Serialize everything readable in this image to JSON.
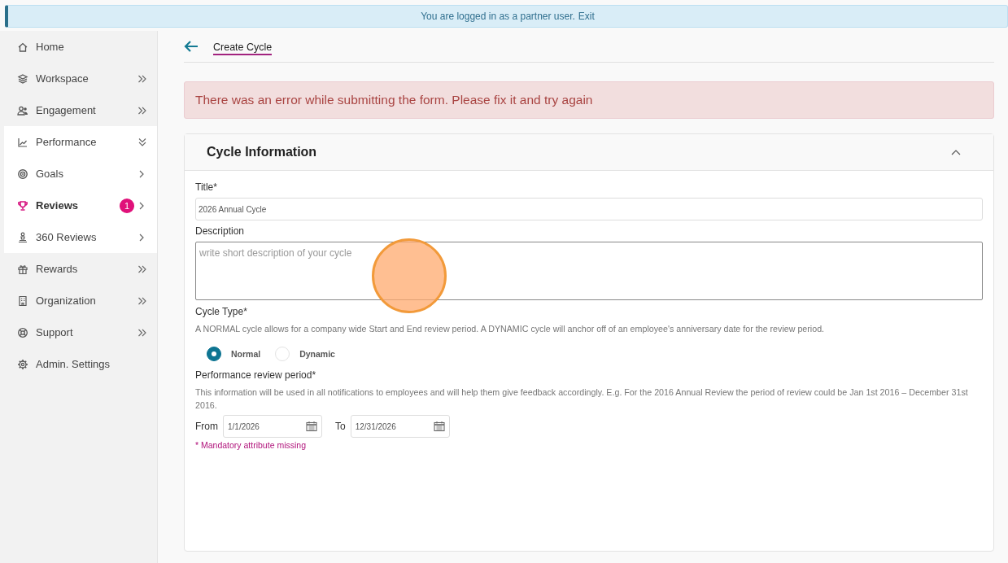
{
  "banner": {
    "text": "You are logged in as a partner user.",
    "link": "Exit"
  },
  "sidebar": {
    "items": [
      {
        "label": "Home",
        "kind": "plain",
        "selected": false
      },
      {
        "label": "Workspace",
        "kind": "module",
        "selected": false
      },
      {
        "label": "Engagement",
        "kind": "module",
        "selected": false
      },
      {
        "label": "Performance",
        "kind": "module",
        "selected": false,
        "expanded": true,
        "children": [
          {
            "label": "Goals",
            "kind": "page",
            "selected": false
          },
          {
            "label": "Reviews",
            "kind": "page",
            "selected": true,
            "badge": "1"
          },
          {
            "label": "360 Reviews",
            "kind": "page",
            "selected": false
          }
        ]
      },
      {
        "label": "Rewards",
        "kind": "module",
        "selected": false
      },
      {
        "label": "Organization",
        "kind": "module",
        "selected": false
      },
      {
        "label": "Support",
        "kind": "module",
        "selected": false
      },
      {
        "label": "Admin. Settings",
        "kind": "plain",
        "selected": false
      }
    ]
  },
  "page": {
    "title": "Create Cycle"
  },
  "error_alert": "There was an error while submitting the form. Please fix it and try again",
  "section": {
    "title": "Cycle Information",
    "expanded": true,
    "title_field": {
      "label": "Title*",
      "value": "2026 Annual Cycle"
    },
    "description_field": {
      "label": "Description",
      "placeholder": "write short description of your cycle"
    },
    "cycle_type": {
      "label": "Cycle Type*",
      "help": "A NORMAL cycle allows for a company wide Start and End review period. A DYNAMIC cycle will anchor off of an employee's anniversary date for the review period.",
      "options": [
        {
          "label": "Normal",
          "selected": true
        },
        {
          "label": "Dynamic",
          "selected": false
        }
      ]
    },
    "review_period": {
      "label": "Performance review period*",
      "help": "This information will be used in all notifications to employees and will help them give feedback accordingly. E.g. For the 2016 Annual Review the period of review could be Jan 1st 2016 – December 31st 2016.",
      "from": {
        "label": "From",
        "value": "1/1/2026"
      },
      "to": {
        "label": "To",
        "value": "12/31/2026"
      },
      "error": "* Mandatory attribute missing"
    }
  }
}
